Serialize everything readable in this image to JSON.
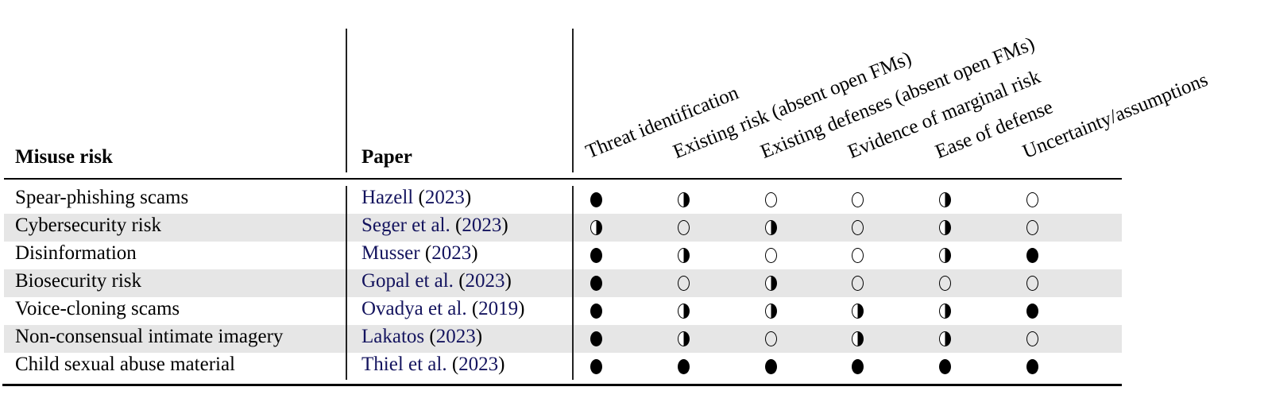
{
  "table": {
    "headers": {
      "misuse_risk": "Misuse risk",
      "paper": "Paper",
      "criteria": [
        "Threat identification",
        "Existing risk (absent open FMs)",
        "Existing defenses (absent open FMs)",
        "Evidence of marginal risk",
        "Ease of defense",
        "Uncertainty/assumptions"
      ]
    },
    "rows": [
      {
        "risk": "Spear-phishing scams",
        "author": "Hazell",
        "year": "2023",
        "ratings": [
          "full",
          "half",
          "empty",
          "empty",
          "half",
          "empty"
        ]
      },
      {
        "risk": "Cybersecurity risk",
        "author": "Seger et al.",
        "year": "2023",
        "ratings": [
          "half",
          "empty",
          "half",
          "empty",
          "half",
          "empty"
        ]
      },
      {
        "risk": "Disinformation",
        "author": "Musser",
        "year": "2023",
        "ratings": [
          "full",
          "half",
          "empty",
          "empty",
          "half",
          "full"
        ]
      },
      {
        "risk": "Biosecurity risk",
        "author": "Gopal et al.",
        "year": "2023",
        "ratings": [
          "full",
          "empty",
          "half",
          "empty",
          "empty",
          "empty"
        ]
      },
      {
        "risk": "Voice-cloning scams",
        "author": "Ovadya et al.",
        "year": "2019",
        "ratings": [
          "full",
          "half",
          "half",
          "half",
          "half",
          "full"
        ]
      },
      {
        "risk": "Non-consensual intimate imagery",
        "author": "Lakatos",
        "year": "2023",
        "ratings": [
          "full",
          "half",
          "empty",
          "half",
          "half",
          "empty"
        ]
      },
      {
        "risk": "Child sexual abuse material",
        "author": "Thiel et al.",
        "year": "2023",
        "ratings": [
          "full",
          "full",
          "full",
          "full",
          "full",
          "full"
        ]
      }
    ],
    "rating_legend": {
      "full": "filled-circle",
      "half": "half-filled-circle",
      "empty": "empty-circle"
    },
    "colors": {
      "citation": "#14145e",
      "row_shade": "#e6e6e6"
    }
  }
}
